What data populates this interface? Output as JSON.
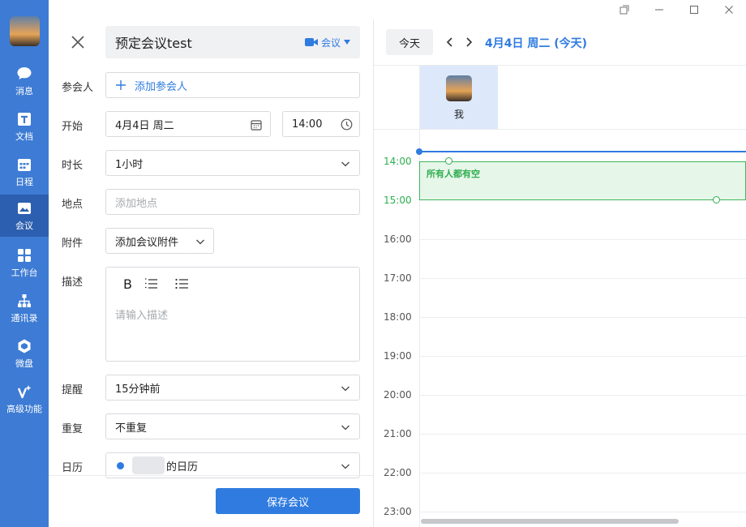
{
  "sidebar": {
    "items": [
      {
        "label": "消息",
        "icon": "chat-bubble-icon"
      },
      {
        "label": "文档",
        "icon": "document-icon"
      },
      {
        "label": "日程",
        "icon": "calendar-icon"
      },
      {
        "label": "会议",
        "icon": "meeting-icon"
      },
      {
        "label": "工作台",
        "icon": "grid-icon"
      },
      {
        "label": "通讯录",
        "icon": "org-chart-icon"
      },
      {
        "label": "微盘",
        "icon": "drive-icon"
      },
      {
        "label": "高级功能",
        "icon": "sparkle-icon"
      }
    ],
    "active_index": 3
  },
  "form": {
    "title": "预定会议test",
    "meeting_label": "会议",
    "attendees_label": "参会人",
    "attendees_placeholder": "添加参会人",
    "start_label": "开始",
    "start_date": "4月4日 周二",
    "start_time": "14:00",
    "duration_label": "时长",
    "duration_value": "1小时",
    "location_label": "地点",
    "location_placeholder": "添加地点",
    "attachment_label": "附件",
    "attachment_button": "添加会议附件",
    "description_label": "描述",
    "description_bold": "B",
    "description_placeholder": "请输入描述",
    "reminder_label": "提醒",
    "reminder_value": "15分钟前",
    "repeat_label": "重复",
    "repeat_value": "不重复",
    "calendar_label": "日历",
    "calendar_value": "的日历",
    "save_button": "保存会议"
  },
  "calendar": {
    "today_button": "今天",
    "date_heading": "4月4日 周二 (今天)",
    "person_name": "我",
    "free_label": "所有人都有空",
    "times": [
      "14:00",
      "15:00",
      "16:00",
      "17:00",
      "18:00",
      "19:00",
      "20:00",
      "21:00",
      "22:00",
      "23:00"
    ]
  },
  "colors": {
    "sidebar": "#3d7bd4",
    "accent": "#2f7be0",
    "free_slot": "#2eae4e"
  }
}
